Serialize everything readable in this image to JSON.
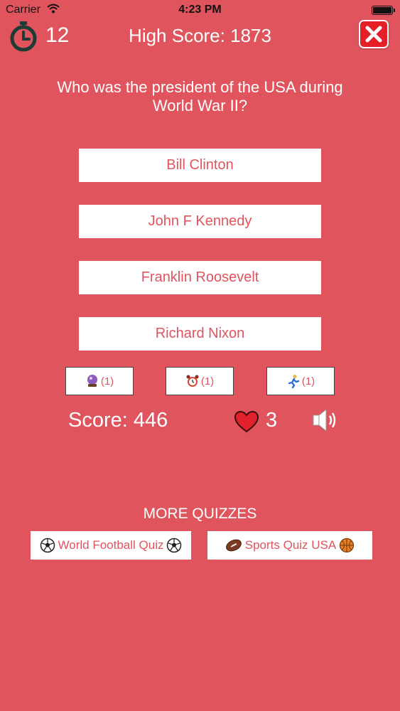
{
  "status_bar": {
    "carrier": "Carrier",
    "time": "4:23 PM"
  },
  "header": {
    "timer_value": "12",
    "high_score": "High Score: 1873"
  },
  "question": "Who was the president of the USA during World War II?",
  "answers": [
    "Bill Clinton",
    "John F Kennedy",
    "Franklin Roosevelt",
    "Richard Nixon"
  ],
  "powerups": [
    {
      "icon": "crystal-ball-icon",
      "count": "(1)"
    },
    {
      "icon": "alarm-clock-icon",
      "count": "(1)"
    },
    {
      "icon": "runner-icon",
      "count": "(1)"
    }
  ],
  "score": "Score: 446",
  "lives": "3",
  "more_quizzes": {
    "title": "MORE QUIZZES",
    "items": [
      {
        "label": "World Football Quiz",
        "icon": "soccer-ball-icon"
      },
      {
        "label": "Sports Quiz USA",
        "icon": "football-icon"
      }
    ]
  },
  "colors": {
    "background": "#e0545e",
    "accent_text": "#e0545e",
    "close_button": "#e51f27"
  }
}
